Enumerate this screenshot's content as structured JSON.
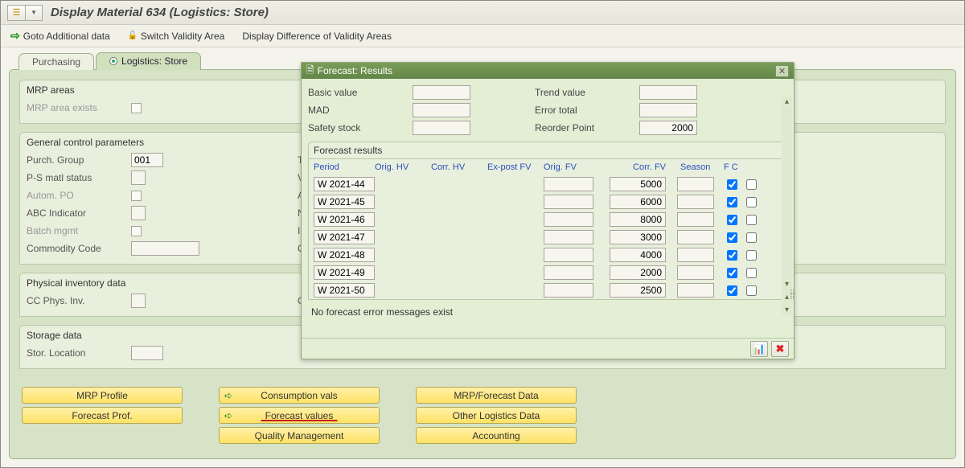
{
  "header": {
    "title": "Display Material 634 (Logistics: Store)"
  },
  "toolbar": {
    "goto": "Goto Additional data",
    "switch": "Switch Validity Area",
    "diff": "Display Difference of Validity Areas"
  },
  "tabs": {
    "purchasing": "Purchasing",
    "logistics": "Logistics: Store"
  },
  "groups": {
    "mrp_areas": {
      "title": "MRP areas",
      "mrp_area_exists": "MRP area exists"
    },
    "gcp": {
      "title": "General control parameters",
      "purch_group": "Purch. Group",
      "purch_group_val": "001",
      "ps_status": "P-S matl status",
      "autom_po": "Autom. PO",
      "abc": "ABC Indicator",
      "batch": "Batch mgmt",
      "commodity": "Commodity Code",
      "tax_ind": "Tax ind",
      "valid_fr": "Valid Fr",
      "avail_c": "Avail. c",
      "neg": "Neg.sto",
      "insp": "Insp.sto",
      "comm": "Comm."
    },
    "phys": {
      "title": "Physical inventory data",
      "cc_phys": "CC Phys. Inv.",
      "cc_ind": "CC ind."
    },
    "storage": {
      "title": "Storage data",
      "stor_loc": "Stor. Location"
    }
  },
  "buttons": {
    "mrp_profile": "MRP Profile",
    "forecast_prof": "Forecast Prof.",
    "consumption": "Consumption vals",
    "forecast_vals": "Forecast values",
    "quality": "Quality Management",
    "mrp_fc_data": "MRP/Forecast Data",
    "other_log": "Other Logistics Data",
    "accounting": "Accounting"
  },
  "popup": {
    "title": "Forecast: Results",
    "basic_value": "Basic value",
    "mad": "MAD",
    "safety_stock": "Safety stock",
    "trend_value": "Trend value",
    "error_total": "Error total",
    "reorder_point": "Reorder Point",
    "reorder_point_val": "2000",
    "group": "Forecast results",
    "cols": {
      "period": "Period",
      "orig_hv": "Orig. HV",
      "corr_hv": "Corr. HV",
      "ex_post": "Ex-post FV",
      "orig_fv": "Orig. FV",
      "corr_fv": "Corr. FV",
      "season": "Season",
      "fc": "F  C"
    },
    "rows": [
      {
        "period": "W 2021-44",
        "corr_fv": "5000"
      },
      {
        "period": "W 2021-45",
        "corr_fv": "6000"
      },
      {
        "period": "W 2021-46",
        "corr_fv": "8000"
      },
      {
        "period": "W 2021-47",
        "corr_fv": "3000"
      },
      {
        "period": "W 2021-48",
        "corr_fv": "4000"
      },
      {
        "period": "W 2021-49",
        "corr_fv": "2000"
      },
      {
        "period": "W 2021-50",
        "corr_fv": "2500"
      }
    ],
    "status": "No forecast error messages exist"
  }
}
